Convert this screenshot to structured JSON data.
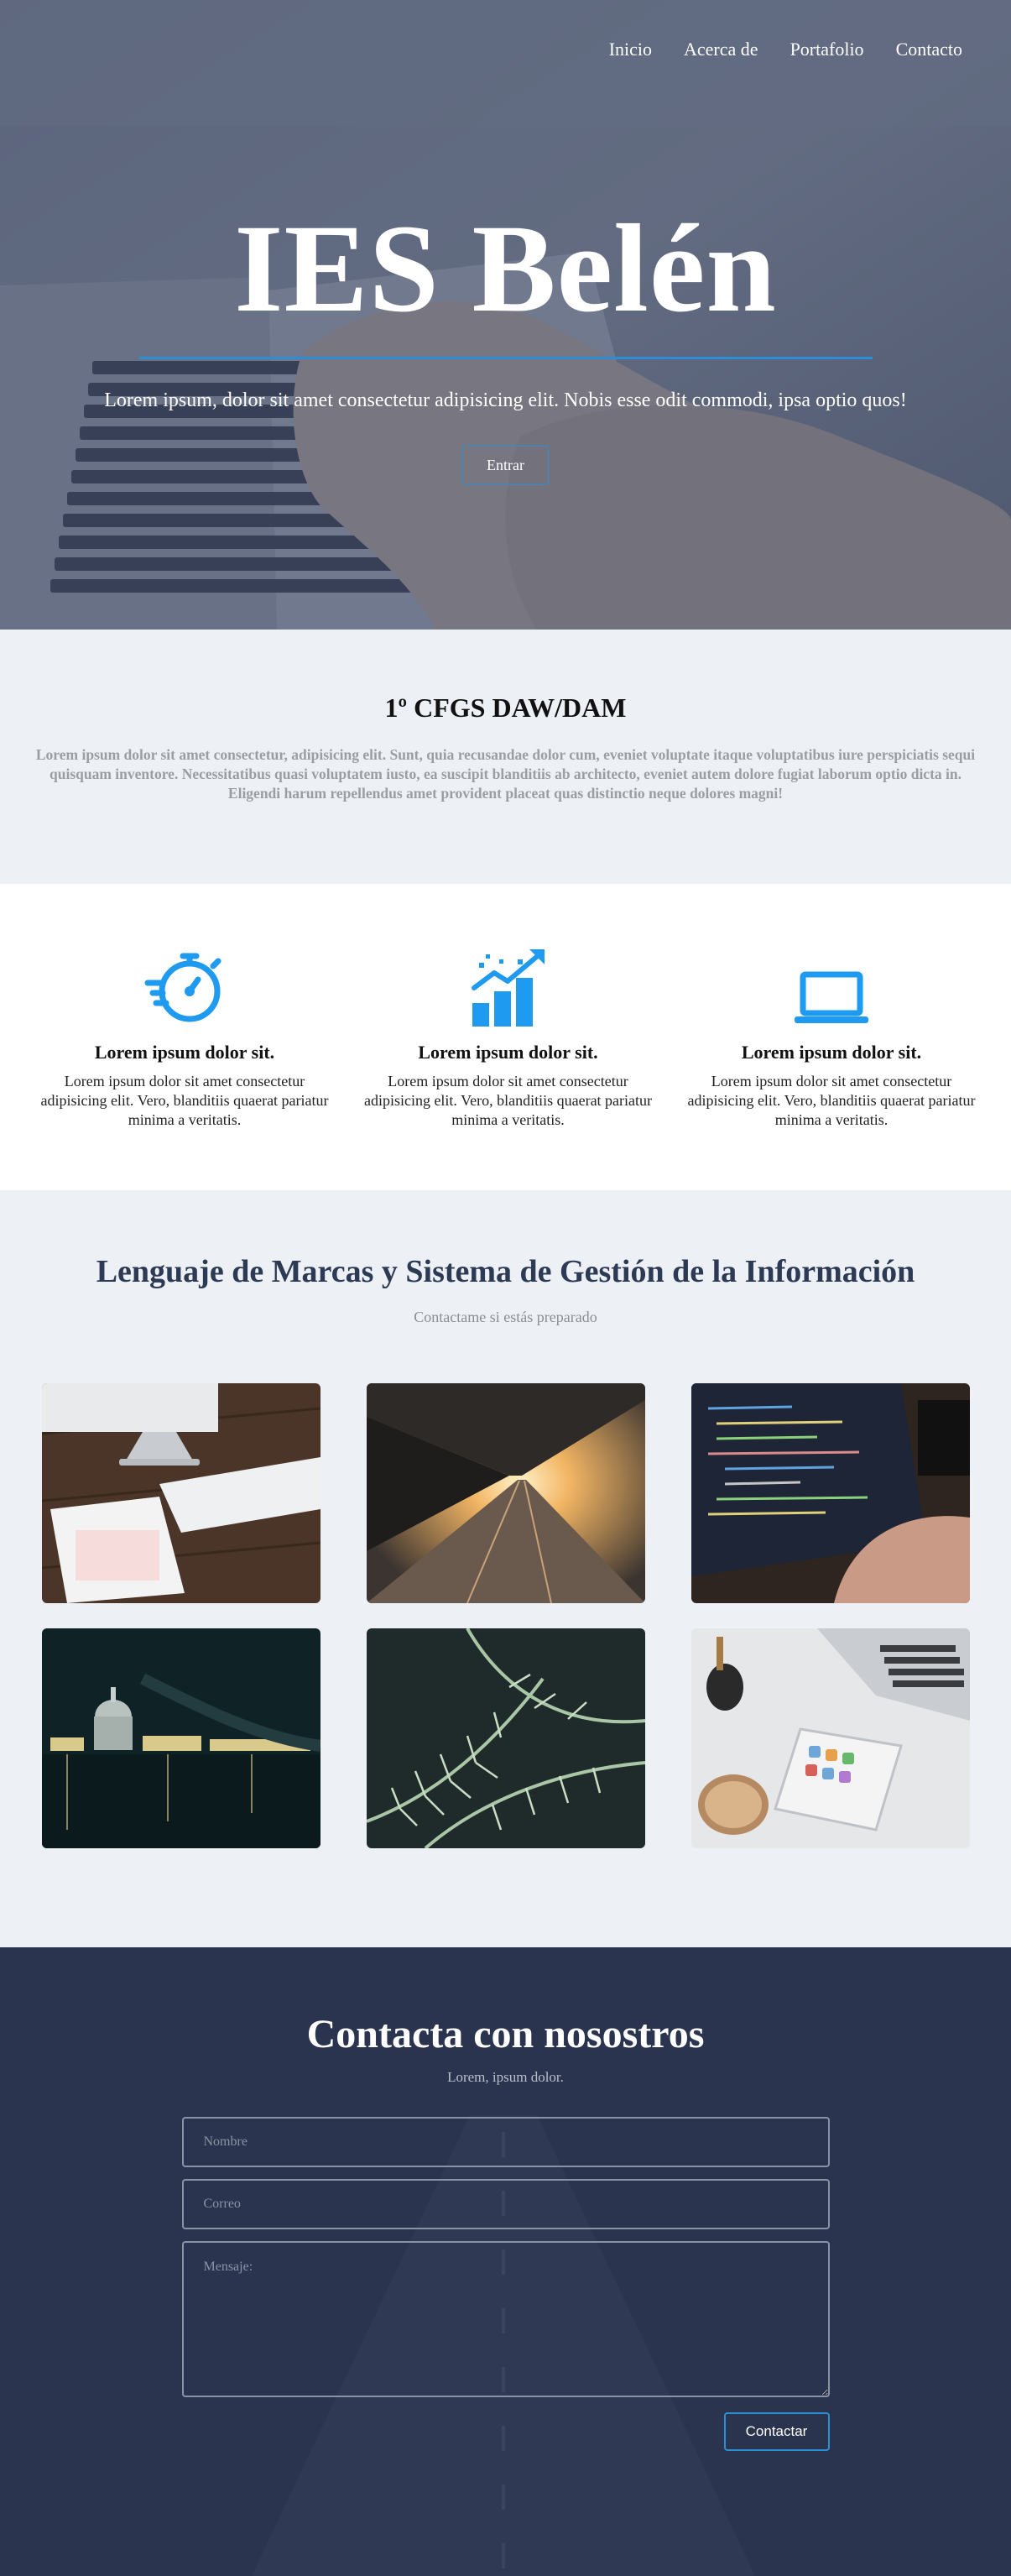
{
  "nav": {
    "items": [
      "Inicio",
      "Acerca de",
      "Portafolio",
      "Contacto"
    ]
  },
  "hero": {
    "title": "IES Belén",
    "subtitle": "Lorem ipsum, dolor sit amet consectetur adipisicing elit. Nobis esse odit commodi, ipsa optio quos!",
    "button": "Entrar"
  },
  "intro": {
    "title": "1º CFGS DAW/DAM",
    "text": "Lorem ipsum dolor sit amet consectetur, adipisicing elit. Sunt, quia recusandae dolor cum, eveniet voluptate itaque voluptatibus iure perspiciatis sequi quisquam inventore. Necessitatibus quasi voluptatem iusto, ea suscipit blanditiis ab architecto, eveniet autem dolore fugiat laborum optio dicta in. Eligendi harum repellendus amet provident placeat quas distinctio neque dolores magni!"
  },
  "features": [
    {
      "icon": "stopwatch-icon",
      "title": "Lorem ipsum dolor sit.",
      "text": "Lorem ipsum dolor sit amet consectetur adipisicing elit. Vero, blanditiis quaerat pariatur minima a veritatis."
    },
    {
      "icon": "growth-chart-icon",
      "title": "Lorem ipsum dolor sit.",
      "text": "Lorem ipsum dolor sit amet consectetur adipisicing elit. Vero, blanditiis quaerat pariatur minima a veritatis."
    },
    {
      "icon": "laptop-icon",
      "title": "Lorem ipsum dolor sit.",
      "text": "Lorem ipsum dolor sit amet consectetur adipisicing elit. Vero, blanditiis quaerat pariatur minima a veritatis."
    }
  ],
  "portfolio": {
    "title": "Lenguaje de Marcas y Sistema de Gestión de la Información",
    "subtitle": "Contactame si estás preparado",
    "images": [
      "desk-imac-photo",
      "train-station-photo",
      "laptop-code-photo",
      "night-city-photo",
      "fern-leaves-photo",
      "phone-laptop-desk-photo"
    ]
  },
  "contact": {
    "title": "Contacta con nosostros",
    "subtitle": "Lorem, ipsum dolor.",
    "name_placeholder": "Nombre",
    "email_placeholder": "Correo",
    "message_placeholder": "Mensaje:",
    "button": "Contactar"
  },
  "colors": {
    "accent": "#2c8fd6",
    "icon_blue": "#1e9af0",
    "heading_dark": "#2c3a55",
    "section_bg": "#edf1f5"
  }
}
